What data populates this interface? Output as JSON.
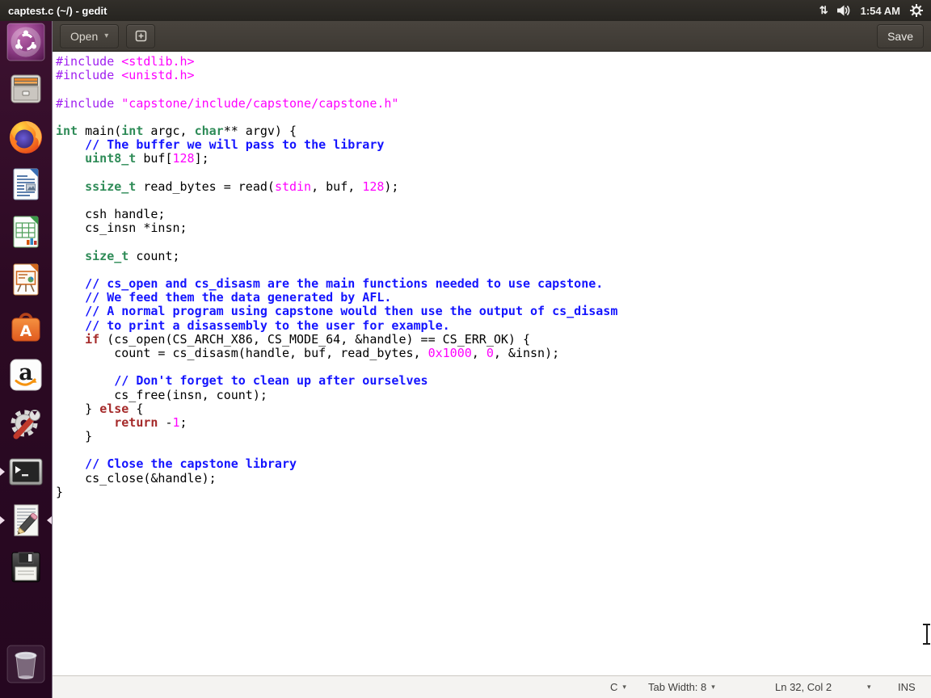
{
  "desktop_bar": {
    "title": "captest.c (~/) - gedit",
    "clock": "1:54 AM"
  },
  "icons": {
    "chevron_down": "▾",
    "network_arrows": "⇅"
  },
  "launcher": {
    "items": [
      {
        "icon": "ubuntu-dash-icon"
      },
      {
        "icon": "files-icon"
      },
      {
        "icon": "firefox-icon"
      },
      {
        "icon": "libreoffice-writer-icon"
      },
      {
        "icon": "libreoffice-calc-icon"
      },
      {
        "icon": "libreoffice-impress-icon"
      },
      {
        "icon": "ubuntu-software-icon"
      },
      {
        "icon": "amazon-icon"
      },
      {
        "icon": "system-settings-icon"
      },
      {
        "icon": "terminal-icon",
        "running": true
      },
      {
        "icon": "gedit-icon",
        "running": true,
        "focused": true
      },
      {
        "icon": "floppy-disk-icon"
      },
      {
        "icon": "trash-icon"
      }
    ]
  },
  "toolbar": {
    "open_label": "Open",
    "save_label": "Save"
  },
  "editor": {
    "lines": [
      [
        [
          "pp",
          "#include"
        ],
        [
          "pl",
          " "
        ],
        [
          "str",
          "<stdlib.h>"
        ]
      ],
      [
        [
          "pp",
          "#include"
        ],
        [
          "pl",
          " "
        ],
        [
          "str",
          "<unistd.h>"
        ]
      ],
      [],
      [
        [
          "pp",
          "#include"
        ],
        [
          "pl",
          " "
        ],
        [
          "str",
          "\"capstone/include/capstone/capstone.h\""
        ]
      ],
      [],
      [
        [
          "typ",
          "int"
        ],
        [
          "pl",
          " main("
        ],
        [
          "typ",
          "int"
        ],
        [
          "pl",
          " argc, "
        ],
        [
          "typ",
          "char"
        ],
        [
          "pl",
          "** argv) {"
        ]
      ],
      [
        [
          "pl",
          "    "
        ],
        [
          "com",
          "// The buffer we will pass to the library"
        ]
      ],
      [
        [
          "pl",
          "    "
        ],
        [
          "typ",
          "uint8_t"
        ],
        [
          "pl",
          " buf["
        ],
        [
          "num",
          "128"
        ],
        [
          "pl",
          "];"
        ]
      ],
      [],
      [
        [
          "pl",
          "    "
        ],
        [
          "typ",
          "ssize_t"
        ],
        [
          "pl",
          " read_bytes = read("
        ],
        [
          "std",
          "stdin"
        ],
        [
          "pl",
          ", buf, "
        ],
        [
          "num",
          "128"
        ],
        [
          "pl",
          ");"
        ]
      ],
      [],
      [
        [
          "pl",
          "    csh handle;"
        ]
      ],
      [
        [
          "pl",
          "    cs_insn *insn;"
        ]
      ],
      [],
      [
        [
          "pl",
          "    "
        ],
        [
          "typ",
          "size_t"
        ],
        [
          "pl",
          " count;"
        ]
      ],
      [],
      [
        [
          "pl",
          "    "
        ],
        [
          "com",
          "// cs_open and cs_disasm are the main functions needed to use capstone."
        ]
      ],
      [
        [
          "pl",
          "    "
        ],
        [
          "com",
          "// We feed them the data generated by AFL."
        ]
      ],
      [
        [
          "pl",
          "    "
        ],
        [
          "com",
          "// A normal program using capstone would then use the output of cs_disasm"
        ]
      ],
      [
        [
          "pl",
          "    "
        ],
        [
          "com",
          "// to print a disassembly to the user for example."
        ]
      ],
      [
        [
          "pl",
          "    "
        ],
        [
          "kw",
          "if"
        ],
        [
          "pl",
          " (cs_open(CS_ARCH_X86, CS_MODE_64, &handle) == CS_ERR_OK) {"
        ]
      ],
      [
        [
          "pl",
          "        count = cs_disasm(handle, buf, read_bytes, "
        ],
        [
          "num",
          "0x1000"
        ],
        [
          "pl",
          ", "
        ],
        [
          "num",
          "0"
        ],
        [
          "pl",
          ", &insn);"
        ]
      ],
      [],
      [
        [
          "pl",
          "        "
        ],
        [
          "com",
          "// Don't forget to clean up after ourselves"
        ]
      ],
      [
        [
          "pl",
          "        cs_free(insn, count);"
        ]
      ],
      [
        [
          "pl",
          "    } "
        ],
        [
          "kw",
          "else"
        ],
        [
          "pl",
          " {"
        ]
      ],
      [
        [
          "pl",
          "        "
        ],
        [
          "kw",
          "return"
        ],
        [
          "pl",
          " -"
        ],
        [
          "num",
          "1"
        ],
        [
          "pl",
          ";"
        ]
      ],
      [
        [
          "pl",
          "    }"
        ]
      ],
      [],
      [
        [
          "pl",
          "    "
        ],
        [
          "com",
          "// Close the capstone library"
        ]
      ],
      [
        [
          "pl",
          "    cs_close(&handle);"
        ]
      ],
      [
        [
          "pl",
          "}"
        ]
      ]
    ]
  },
  "statusbar": {
    "language": "C",
    "tab_width": "Tab Width: 8",
    "cursor_position": "Ln 32, Col 2",
    "input_mode": "INS"
  },
  "colors": {
    "syntax_preprocessor": "#a020f0",
    "syntax_string": "#ff00ff",
    "syntax_number": "#ff00ff",
    "syntax_type": "#2e8b57",
    "syntax_keyword": "#a52a2a",
    "syntax_comment": "#1414ff",
    "topbar_bg": "#2c2925",
    "toolbar_bg": "#443f39",
    "launcher_bg": "#2f0b26",
    "editor_bg": "#ffffff",
    "statusbar_bg": "#f4f3f1"
  }
}
